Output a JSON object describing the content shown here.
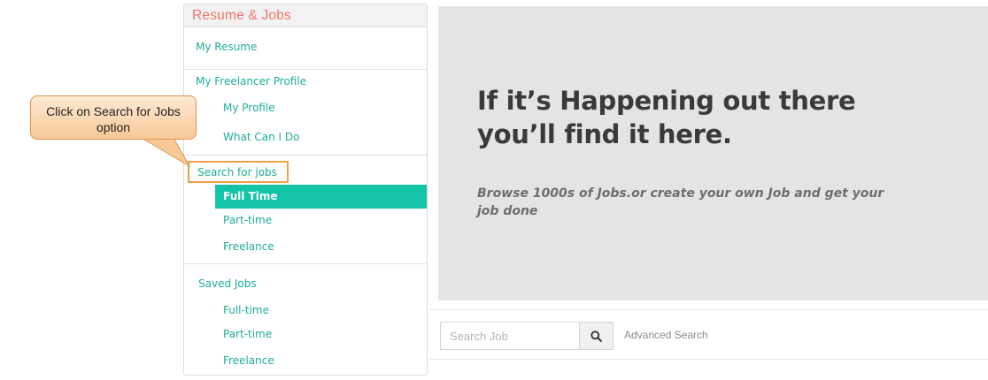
{
  "sidebar": {
    "title": "Resume & Jobs",
    "my_resume": "My Resume",
    "freelancer_profile": "My Freelancer Profile",
    "my_profile": "My Profile",
    "what_can_i_do": "What Can I Do",
    "search_for_jobs": "Search for jobs",
    "search_sub": [
      "Full Time",
      "Part-time",
      "Freelance"
    ],
    "active_item": "Full Time",
    "saved_jobs": "Saved Jobs",
    "saved_sub": [
      "Full-time",
      "Part-time",
      "Freelance"
    ]
  },
  "callout": {
    "line1": "Click on Search for Jobs",
    "line2": "option"
  },
  "hero": {
    "title_line1": "If it’s Happening out there",
    "title_line2": "you’ll find it here.",
    "subtitle_line1": "Browse 1000s of Jobs.or create your own Job and get your",
    "subtitle_line2": "job done"
  },
  "search": {
    "placeholder": "Search Job",
    "value": "",
    "button_icon": "search-icon",
    "advanced_label": "Advanced Search"
  },
  "colors": {
    "accent": "#14c4a8",
    "link": "#1fae97",
    "header_text": "#f0766b",
    "callout_border": "#e0954f",
    "highlight_border": "#f0a04b"
  }
}
